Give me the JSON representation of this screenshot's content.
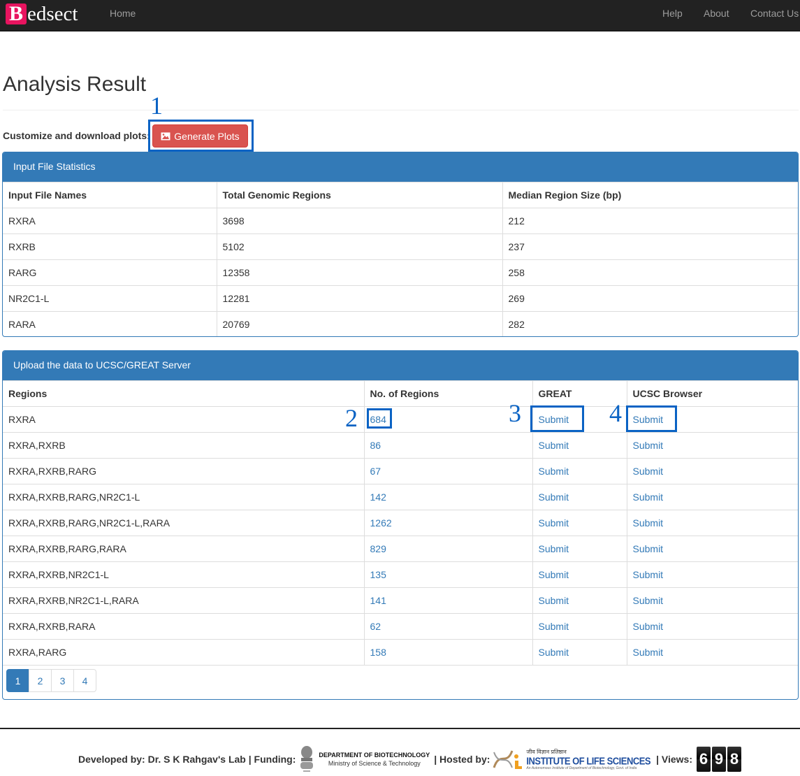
{
  "navbar": {
    "brand_initial": "B",
    "brand_rest": "edsect",
    "links": [
      "Home",
      "Help",
      "About",
      "Contact Us"
    ]
  },
  "page_title": "Analysis Result",
  "customize_label": "Customize and download plots:",
  "generate_button": "Generate Plots",
  "annotations": [
    "1",
    "2",
    "3",
    "4"
  ],
  "input_stats": {
    "heading": "Input File Statistics",
    "columns": [
      "Input File Names",
      "Total Genomic Regions",
      "Median Region Size (bp)"
    ],
    "rows": [
      [
        "RXRA",
        "3698",
        "212"
      ],
      [
        "RXRB",
        "5102",
        "237"
      ],
      [
        "RARG",
        "12358",
        "258"
      ],
      [
        "NR2C1-L",
        "12281",
        "269"
      ],
      [
        "RARA",
        "20769",
        "282"
      ]
    ]
  },
  "upload": {
    "heading": "Upload the data to UCSC/GREAT Server",
    "columns": [
      "Regions",
      "No. of Regions",
      "GREAT",
      "UCSC Browser"
    ],
    "submit_label": "Submit",
    "rows": [
      [
        "RXRA",
        "684"
      ],
      [
        "RXRA,RXRB",
        "86"
      ],
      [
        "RXRA,RXRB,RARG",
        "67"
      ],
      [
        "RXRA,RXRB,RARG,NR2C1-L",
        "142"
      ],
      [
        "RXRA,RXRB,RARG,NR2C1-L,RARA",
        "1262"
      ],
      [
        "RXRA,RXRB,RARG,RARA",
        "829"
      ],
      [
        "RXRA,RXRB,NR2C1-L",
        "135"
      ],
      [
        "RXRA,RXRB,NR2C1-L,RARA",
        "141"
      ],
      [
        "RXRA,RXRB,RARA",
        "62"
      ],
      [
        "RXRA,RARG",
        "158"
      ]
    ],
    "pages": [
      "1",
      "2",
      "3",
      "4"
    ],
    "active_page": "1"
  },
  "footer": {
    "developed": "Developed by: Dr. S K Rahgav's Lab | Funding:",
    "dbt_title": "DEPARTMENT OF BIOTECHNOLOGY",
    "dbt_sub": "Ministry of Science & Technology",
    "hosted": "| Hosted by:",
    "ils_hindi": "जीव विज्ञान प्रतिष्ठान",
    "ils_title": "INSTITUTE OF LIFE SCIENCES",
    "ils_sub": "An Autonomous Institute of Department of Biotechnology, Govt. of India",
    "views_label": "| Views:",
    "views": [
      "6",
      "9",
      "8"
    ]
  }
}
